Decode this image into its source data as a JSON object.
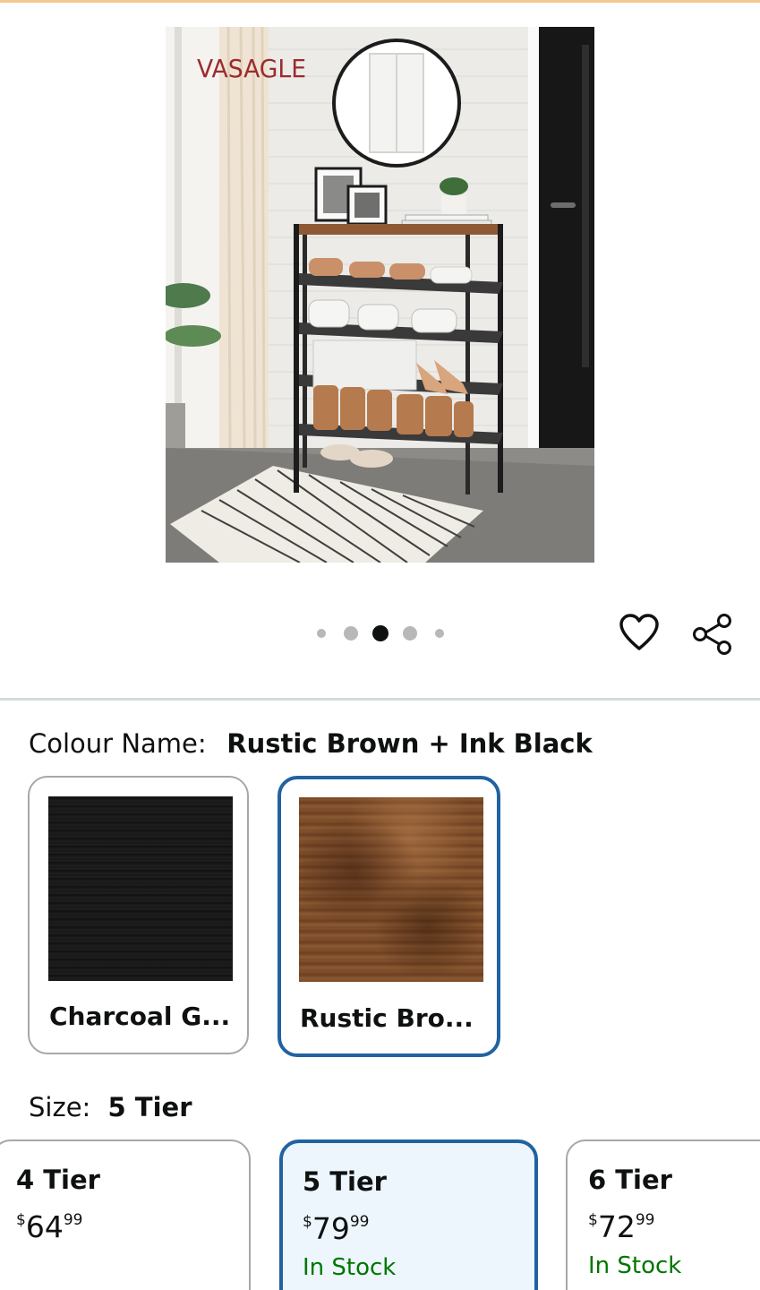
{
  "product": {
    "brand_logo": "VASAGLE",
    "image_alt": "5 tier shoe rack in hallway"
  },
  "carousel": {
    "count": 5,
    "active_index": 2
  },
  "actions": {
    "wishlist_icon": "heart-outline-icon",
    "share_icon": "share-icon"
  },
  "colour": {
    "label": "Colour Name:",
    "selected": "Rustic Brown + Ink Black",
    "options": [
      {
        "label": "Charcoal G...",
        "swatch": "#1a1a1a",
        "selected": false
      },
      {
        "label": "Rustic Bro...",
        "swatch": "#7a4a28",
        "selected": true
      }
    ]
  },
  "size": {
    "label": "Size:",
    "selected": "5 Tier",
    "options": [
      {
        "name": "4 Tier",
        "currency": "$",
        "whole": "64",
        "fraction": "99",
        "stock": "",
        "selected": false
      },
      {
        "name": "5 Tier",
        "currency": "$",
        "whole": "79",
        "fraction": "99",
        "stock": "In Stock",
        "selected": true
      },
      {
        "name": "6 Tier",
        "currency": "$",
        "whole": "72",
        "fraction": "99",
        "stock": "In Stock",
        "selected": false
      }
    ]
  },
  "colors": {
    "accent": "#2162a1",
    "in_stock": "#007600",
    "selected_bg": "#edf6fd",
    "logo": "#9b2b2e"
  }
}
